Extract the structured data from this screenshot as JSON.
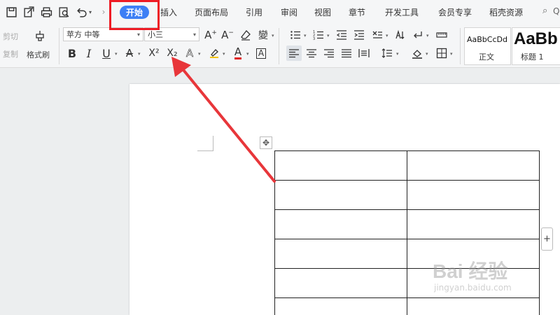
{
  "quick_access": {
    "icons": [
      "save-icon",
      "export-pdf-icon",
      "print-icon",
      "print-preview-icon",
      "undo-icon",
      "undo-dropdown-icon"
    ]
  },
  "menu": {
    "tabs": [
      {
        "label": "开始",
        "active": true
      },
      {
        "label": "插入"
      },
      {
        "label": "页面布局"
      },
      {
        "label": "引用"
      },
      {
        "label": "审阅"
      },
      {
        "label": "视图"
      },
      {
        "label": "章节"
      },
      {
        "label": "开发工具"
      },
      {
        "label": "会员专享"
      },
      {
        "label": "稻壳资源"
      }
    ],
    "search_label": "Q"
  },
  "ribbon": {
    "clipboard": {
      "cut": "剪切",
      "copy": "复制",
      "format_painter": "格式刷"
    },
    "font": {
      "family": "苹方 中等",
      "size": "小三"
    },
    "font_buttons": {
      "bold": "B",
      "italic": "I",
      "underline": "U",
      "strike": "A",
      "superscript": "X²",
      "subscript": "X₂",
      "char_effect": "A",
      "font_color": "A",
      "char_border": "A"
    },
    "size_buttons": {
      "grow": "A⁺",
      "shrink": "A⁻",
      "clear": "◇",
      "phonetic": "變"
    },
    "styles": [
      {
        "sample": "AaBbCcDd",
        "name": "正文"
      },
      {
        "sample": "AaBb",
        "name": "标题 1"
      }
    ]
  },
  "colors": {
    "accent": "#3d7ff5",
    "highlight_box": "#ee1c25",
    "arrow": "#e8363a"
  },
  "table": {
    "rows": 6,
    "cols": 2
  },
  "watermark": {
    "main": "Bai 经验",
    "sub": "jingyan.baidu.com"
  }
}
